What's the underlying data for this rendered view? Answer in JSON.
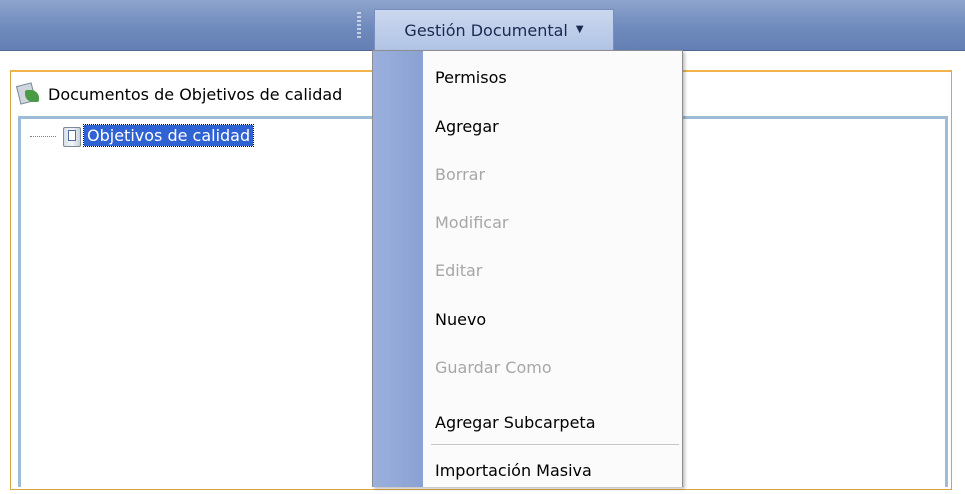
{
  "toolbar": {
    "menu_title": "Gestión Documental"
  },
  "panel": {
    "tab_title": "Documentos de Objetivos de calidad",
    "tree": {
      "node_label": "Objetivos de calidad"
    }
  },
  "menu": {
    "items": [
      {
        "label": "Permisos",
        "enabled": true
      },
      {
        "label": "Agregar",
        "enabled": true
      },
      {
        "label": "Borrar",
        "enabled": false
      },
      {
        "label": "Modificar",
        "enabled": false
      },
      {
        "label": "Editar",
        "enabled": false
      },
      {
        "label": "Nuevo",
        "enabled": true
      },
      {
        "label": "Guardar Como",
        "enabled": false
      },
      {
        "label": "Agregar Subcarpeta",
        "enabled": true
      },
      {
        "label": "Importación Masiva",
        "enabled": true
      }
    ]
  },
  "icons": {
    "tab_icon": "documents-icon",
    "tree_icon": "folder-icon",
    "caret": "chevron-down-icon"
  },
  "colors": {
    "toolbar": "#6f8abd",
    "menu_strip": "#8aa1d3",
    "selection": "#2f62d2",
    "panel_border": "#f0b44a"
  }
}
